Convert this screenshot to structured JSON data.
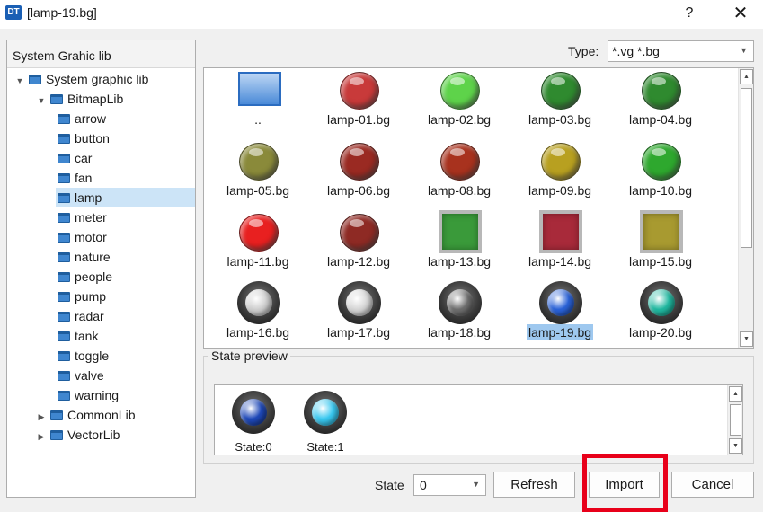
{
  "window": {
    "title": "[lamp-19.bg]",
    "app_icon": "DT",
    "help_label": "?",
    "close_label": "✕"
  },
  "tree": {
    "header": "System Grahic lib",
    "items": [
      {
        "label": "System graphic lib",
        "expanded": true
      },
      {
        "label": "BitmapLib",
        "expanded": true
      },
      {
        "label": "arrow"
      },
      {
        "label": "button"
      },
      {
        "label": "car"
      },
      {
        "label": "fan"
      },
      {
        "label": "lamp",
        "selected": true
      },
      {
        "label": "meter"
      },
      {
        "label": "motor"
      },
      {
        "label": "nature"
      },
      {
        "label": "people"
      },
      {
        "label": "pump"
      },
      {
        "label": "radar"
      },
      {
        "label": "tank"
      },
      {
        "label": "toggle"
      },
      {
        "label": "valve"
      },
      {
        "label": "warning"
      },
      {
        "label": "CommonLib",
        "expanded": false
      },
      {
        "label": "VectorLib",
        "expanded": false
      }
    ]
  },
  "type_filter": {
    "label": "Type:",
    "value": "*.vg  *.bg"
  },
  "files": [
    {
      "label": "..",
      "icon": "parent-folder-icon"
    },
    {
      "label": "lamp-01.bg",
      "color": "#c83a3a",
      "style": "round"
    },
    {
      "label": "lamp-02.bg",
      "color": "#5ed34a",
      "style": "round"
    },
    {
      "label": "lamp-03.bg",
      "color": "#2f8a2f",
      "style": "round"
    },
    {
      "label": "lamp-04.bg",
      "color": "#2f8a2f",
      "style": "round"
    },
    {
      "label": "lamp-05.bg",
      "color": "#8a8a3a",
      "style": "round"
    },
    {
      "label": "lamp-06.bg",
      "color": "#9a2a22",
      "style": "round"
    },
    {
      "label": "lamp-08.bg",
      "color": "#a8321e",
      "style": "round"
    },
    {
      "label": "lamp-09.bg",
      "color": "#b8a020",
      "style": "round"
    },
    {
      "label": "lamp-10.bg",
      "color": "#2ea82e",
      "style": "round"
    },
    {
      "label": "lamp-11.bg",
      "color": "#e82020",
      "style": "round"
    },
    {
      "label": "lamp-12.bg",
      "color": "#8e2a24",
      "style": "round"
    },
    {
      "label": "lamp-13.bg",
      "color": "#3a9a3a",
      "style": "square"
    },
    {
      "label": "lamp-14.bg",
      "color": "#a82a3a",
      "style": "square"
    },
    {
      "label": "lamp-15.bg",
      "color": "#a89a30",
      "style": "square"
    },
    {
      "label": "lamp-16.bg",
      "color": "#cfcfcf",
      "style": "bezel"
    },
    {
      "label": "lamp-17.bg",
      "color": "#d6d6d6",
      "style": "bezel"
    },
    {
      "label": "lamp-18.bg",
      "color": "#6e6e6e",
      "style": "bezel"
    },
    {
      "label": "lamp-19.bg",
      "color": "#2a62d8",
      "style": "bezel",
      "selected": true
    },
    {
      "label": "lamp-20.bg",
      "color": "#20b8a0",
      "style": "bezel"
    }
  ],
  "state_preview": {
    "title": "State preview",
    "states": [
      {
        "label": "State:0",
        "color": "#1e48b8"
      },
      {
        "label": "State:1",
        "color": "#38c8f0"
      }
    ]
  },
  "footer": {
    "state_label": "State",
    "state_value": "0",
    "refresh_label": "Refresh",
    "import_label": "Import",
    "cancel_label": "Cancel"
  }
}
